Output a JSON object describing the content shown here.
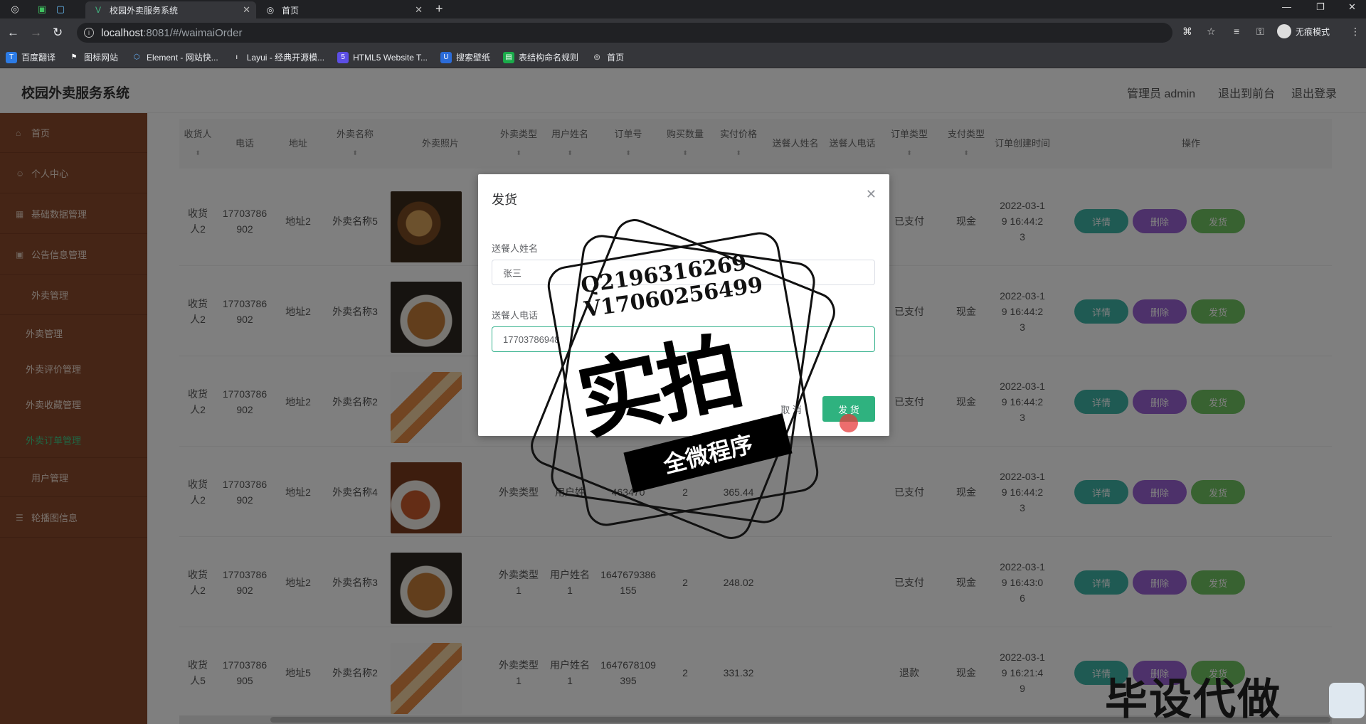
{
  "browser": {
    "active_tab_title": "校园外卖服务系统",
    "second_tab_title": "首页",
    "url_host": "localhost",
    "url_rest": ":8081/#/waimaiOrder",
    "incognito_label": "无痕模式",
    "bookmarks": [
      "百度翻译",
      "图标网站",
      "Element - 网站快...",
      "Layui - 经典开源模...",
      "HTML5 Website T...",
      "搜索壁纸",
      "表结构命名规则",
      "首页"
    ]
  },
  "header": {
    "title": "校园外卖服务系统",
    "admin": "管理员 admin",
    "to_front": "退出到前台",
    "logout": "退出登录"
  },
  "sidebar": {
    "items": [
      "首页",
      "个人中心",
      "基础数据管理",
      "公告信息管理",
      "外卖管理"
    ],
    "sub_items": [
      "外卖管理",
      "外卖评价管理",
      "外卖收藏管理",
      "外卖订单管理"
    ],
    "user_mgmt": "用户管理",
    "carousel": "轮播图信息"
  },
  "table": {
    "headers": [
      "收货人",
      "电话",
      "地址",
      "外卖名称",
      "外卖照片",
      "外卖类型",
      "用户姓名",
      "订单号",
      "购买数量",
      "实付价格",
      "送餐人姓名",
      "送餐人电话",
      "订单类型",
      "支付类型",
      "订单创建时间",
      "操作"
    ],
    "rows": [
      {
        "receiver": "收货人2",
        "phone": "17703786902",
        "addr": "地址2",
        "name": "外卖名称5",
        "type": "",
        "user": "",
        "order_no": "",
        "qty": "",
        "price": "",
        "status": "已支付",
        "pay": "现金",
        "time": "2022-03-19 16:44:23"
      },
      {
        "receiver": "收货人2",
        "phone": "17703786902",
        "addr": "地址2",
        "name": "外卖名称3",
        "type": "",
        "user": "",
        "order_no": "",
        "qty": "",
        "price": "",
        "status": "已支付",
        "pay": "现金",
        "time": "2022-03-19 16:44:23"
      },
      {
        "receiver": "收货人2",
        "phone": "17703786902",
        "addr": "地址2",
        "name": "外卖名称2",
        "type": "",
        "user": "",
        "order_no": "",
        "qty": "",
        "price": "",
        "status": "已支付",
        "pay": "现金",
        "time": "2022-03-19 16:44:23"
      },
      {
        "receiver": "收货人2",
        "phone": "17703786902",
        "addr": "地址2",
        "name": "外卖名称4",
        "type": "外卖类型",
        "user": "用户姓",
        "order_no": "463470",
        "qty": "2",
        "price": "365.44",
        "status": "已支付",
        "pay": "现金",
        "time": "2022-03-19 16:44:23"
      },
      {
        "receiver": "收货人2",
        "phone": "17703786902",
        "addr": "地址2",
        "name": "外卖名称3",
        "type": "外卖类型1",
        "user": "用户姓名1",
        "order_no": "1647679386155",
        "qty": "2",
        "price": "248.02",
        "status": "已支付",
        "pay": "现金",
        "time": "2022-03-19 16:43:06"
      },
      {
        "receiver": "收货人5",
        "phone": "17703786905",
        "addr": "地址5",
        "name": "外卖名称2",
        "type": "外卖类型1",
        "user": "用户姓名1",
        "order_no": "1647678109395",
        "qty": "2",
        "price": "331.32",
        "status": "退款",
        "pay": "现金",
        "time": "2022-03-19 16:21:49"
      }
    ],
    "op_detail": "详情",
    "op_delete": "删除",
    "op_ship": "发货"
  },
  "dialog": {
    "title": "发货",
    "courier_name_label": "送餐人姓名",
    "courier_name_value": "张三",
    "courier_phone_label": "送餐人电话",
    "courier_phone_value": "17703786948",
    "cancel": "取 消",
    "confirm": "发 货"
  },
  "watermark": {
    "qq": "Q2196316269",
    "wx": "V17060256499",
    "big": "实拍",
    "ribbon": "全微程序",
    "corner": "毕设代做"
  }
}
